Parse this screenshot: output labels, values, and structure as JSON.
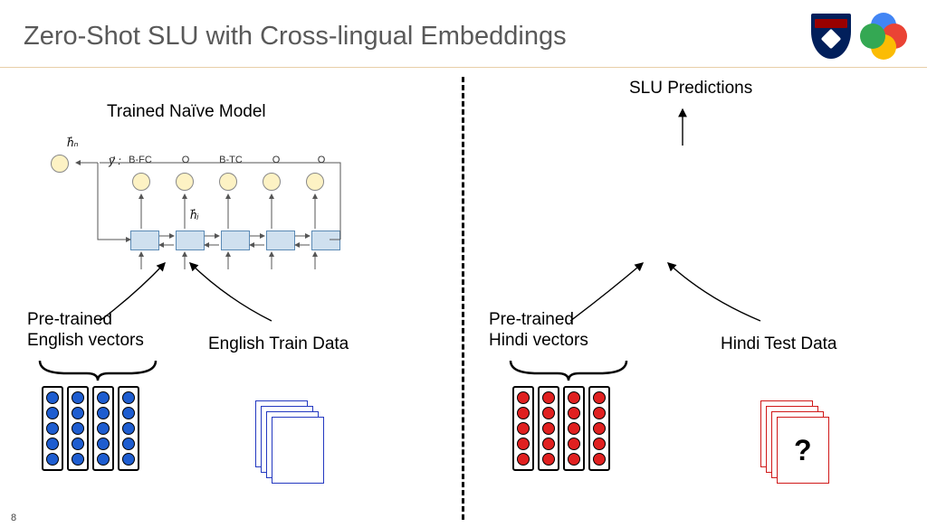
{
  "title": "Zero-Shot SLU with Cross-lingual Embeddings",
  "page_number": "8",
  "left": {
    "model_label": "Trained Naïve Model",
    "vectors_label": "Pre-trained\nEnglish vectors",
    "data_label": "English Train Data",
    "y_prefix": "y⃗ :",
    "hn_label": "h⃗ₙ",
    "hi_label": "h⃗ᵢ",
    "output_tags": [
      "B-FC",
      "O",
      "B-TC",
      "O",
      "O"
    ]
  },
  "right": {
    "predictions_label": "SLU Predictions",
    "vectors_label": "Pre-trained\nHindi vectors",
    "data_label": "Hindi Test Data",
    "question_mark": "?"
  },
  "diagram_data": {
    "type": "architecture",
    "description": "Zero-shot spoken language understanding using cross-lingual embeddings. A naive BiRNN tagger is trained on English data with English vectors, then applied with Hindi vectors on Hindi test data to produce SLU predictions.",
    "left_panel": {
      "inputs": [
        "Pre-trained English vectors",
        "English Train Data"
      ],
      "model": "BiRNN sequence tagger (Trained Naïve Model)",
      "sequence_output_tags": [
        "B-FC",
        "O",
        "B-TC",
        "O",
        "O"
      ],
      "hidden_vectors": [
        "h_i per timestep",
        "h_n final"
      ]
    },
    "right_panel": {
      "inputs": [
        "Pre-trained Hindi vectors",
        "Hindi Test Data (unknown)"
      ],
      "output": "SLU Predictions"
    }
  }
}
